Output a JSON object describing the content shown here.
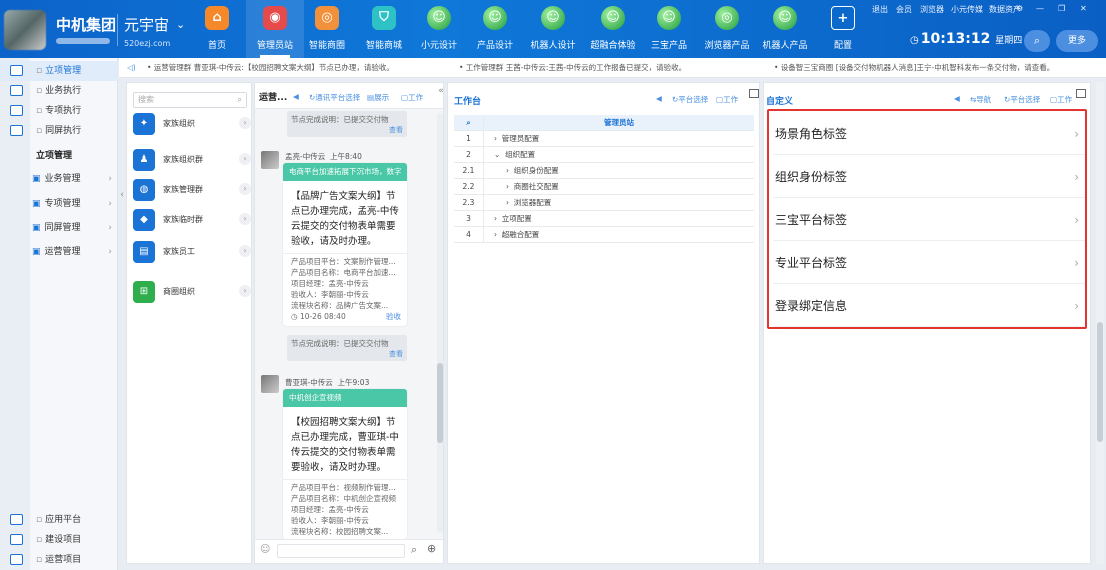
{
  "brand": {
    "name": "中机集团",
    "universe": "元宇宙",
    "url": "520ezj.com"
  },
  "nav": [
    {
      "label": "首页",
      "icon": "home-icon",
      "glyph": "⌂",
      "color": "#f5892a"
    },
    {
      "label": "管理员站",
      "icon": "admin-station-icon",
      "glyph": "◉",
      "color": "#e64b4b",
      "active": true
    },
    {
      "label": "智能商圈",
      "icon": "smart-business-icon",
      "glyph": "◎",
      "color": "#f2913b"
    },
    {
      "label": "智能商城",
      "icon": "smart-mall-icon",
      "glyph": "⛉",
      "color": "#2ec2c7"
    },
    {
      "label": "小元设计",
      "icon": "robot-globe-icon",
      "glyph": "☺",
      "globe": true
    },
    {
      "label": "产品设计",
      "icon": "robot-globe-icon",
      "glyph": "☺",
      "globe": true
    },
    {
      "label": "机器人设计",
      "icon": "robot-globe-icon",
      "glyph": "☺",
      "globe": true
    },
    {
      "label": "超融合体验",
      "icon": "robot-globe-icon",
      "glyph": "☺",
      "globe": true
    },
    {
      "label": "三宝产品",
      "icon": "robot-globe-icon",
      "glyph": "☺",
      "globe": true
    },
    {
      "label": "浏览器产品",
      "icon": "browser-globe-icon",
      "glyph": "◎",
      "globe": true
    },
    {
      "label": "机器人产品",
      "icon": "robot-globe-icon",
      "glyph": "☺",
      "globe": true
    },
    {
      "label": "配置",
      "icon": "add-config-icon",
      "glyph": "+",
      "config": true
    }
  ],
  "toplinks": [
    "退出",
    "会员",
    "浏览器",
    "小元传媒",
    "数据资产"
  ],
  "clock": {
    "time": "10:13:12",
    "day": "星期四"
  },
  "more_label": "更多",
  "sidebar": {
    "top": [
      "立项管理",
      "业务执行",
      "专项执行",
      "同屏执行"
    ],
    "section": "立项管理",
    "groups": [
      "业务管理",
      "专项管理",
      "同屏管理",
      "运营管理"
    ],
    "bottom": [
      "应用平台",
      "建设项目",
      "运营项目"
    ]
  },
  "notices": [
    "• 运营管理群 曹亚琪-中传云:【校园招聘文案大纲】节点已办理，请验收。",
    "• 工作管理群 王茜-中传云:王茜-中传云的工作报备已提交，请验收。",
    "• 设备智三宝商圈 [设备交付物机器人消息]王宁-中机智科发布一条交付物，请查看。"
  ],
  "panel1": {
    "search_placeholder": "搜索",
    "items": [
      {
        "label": "家族组织",
        "glyph": "✦"
      },
      {
        "label": "家族组织群",
        "glyph": "♟"
      },
      {
        "label": "家族管理群",
        "glyph": "◍"
      },
      {
        "label": "家族临时群",
        "glyph": "◆"
      },
      {
        "label": "家族员工",
        "glyph": "▤"
      },
      {
        "label": "商圈组织",
        "glyph": "⊞",
        "green": true
      }
    ]
  },
  "panel2": {
    "title": "运营...",
    "links": [
      "通讯平台选择",
      "展示",
      "工作"
    ],
    "sys1": {
      "text": "节点完成说明：已提交交付物",
      "link": "查看"
    },
    "msg1": {
      "sender": "孟亮-中传云",
      "time": "上午8:40",
      "bar": "电商平台加速拓展下沉市场，数字",
      "body": "【品牌广告文案大纲】节点已办理完成，孟亮-中传云提交的交付物表单需要验收，请及时办理。",
      "meta": [
        "产品项目平台：文案制作管理...",
        "产品项目名称：电商平台加速...",
        "项目经理：孟亮-中传云",
        "验收人：李朝丽-中传云",
        "流程块名称：品牌广告文案..."
      ],
      "date": "10-26 08:40",
      "link": "验收"
    },
    "sys2": {
      "text": "节点完成说明：已提交交付物",
      "link": "查看"
    },
    "msg2": {
      "sender": "曹亚琪-中传云",
      "time": "上午9:03",
      "bar": "中机创企宣视频",
      "body": "【校园招聘文案大纲】节点已办理完成，曹亚琪-中传云提交的交付物表单需要验收，请及时办理。",
      "meta": [
        "产品项目平台：视频制作管理...",
        "产品项目名称：中机创企宣视频",
        "项目经理：孟亮-中传云",
        "验收人：李朝丽-中传云",
        "流程块名称：校园招聘文案..."
      ]
    }
  },
  "panel3": {
    "title": "工作台",
    "links": [
      "平台选择",
      "工作"
    ],
    "header": "管理员站",
    "rows": [
      {
        "n": "1",
        "t": "管理员配置",
        "c": "›"
      },
      {
        "n": "2",
        "t": "组织配置",
        "c": "⌄"
      },
      {
        "n": "2.1",
        "t": "组织身份配置",
        "c": "›"
      },
      {
        "n": "2.2",
        "t": "商圈社交配置",
        "c": "›"
      },
      {
        "n": "2.3",
        "t": "浏览器配置",
        "c": "›"
      },
      {
        "n": "3",
        "t": "立项配置",
        "c": "›"
      },
      {
        "n": "4",
        "t": "超融合配置",
        "c": "›"
      }
    ]
  },
  "panel4": {
    "title": "自定义",
    "links": [
      "导航",
      "平台选择",
      "工作"
    ],
    "tags": [
      "场景角色标签",
      "组织身份标签",
      "三宝平台标签",
      "专业平台标签",
      "登录绑定信息"
    ]
  }
}
